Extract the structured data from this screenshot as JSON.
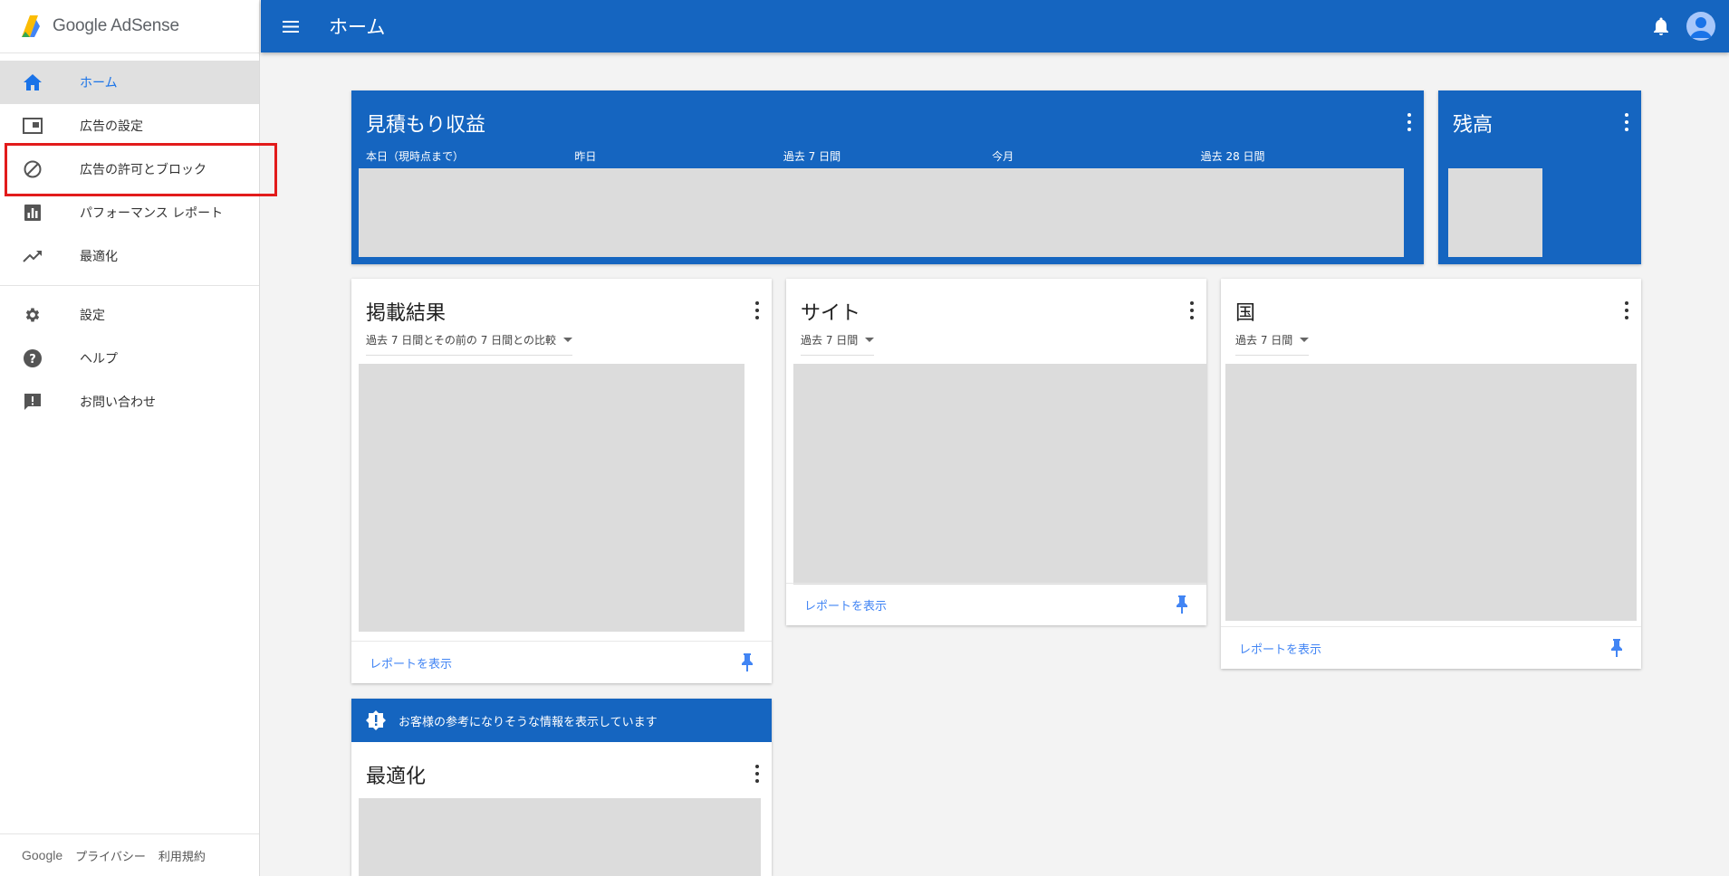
{
  "app": {
    "logo_text": "Google AdSense"
  },
  "header": {
    "title": "ホーム"
  },
  "sidebar": {
    "items": [
      {
        "label": "ホーム",
        "icon": "home-icon",
        "active": true
      },
      {
        "label": "広告の設定",
        "icon": "ad-settings-icon"
      },
      {
        "label": "広告の許可とブロック",
        "icon": "block-icon"
      },
      {
        "label": "パフォーマンス レポート",
        "icon": "bar-chart-icon"
      },
      {
        "label": "最適化",
        "icon": "trending-up-icon"
      },
      {
        "label": "設定",
        "icon": "gear-icon"
      },
      {
        "label": "ヘルプ",
        "icon": "help-icon"
      },
      {
        "label": "お問い合わせ",
        "icon": "feedback-icon"
      }
    ],
    "footer": {
      "google": "Google",
      "privacy": "プライバシー",
      "terms": "利用規約"
    }
  },
  "cards": {
    "estimated": {
      "title": "見積もり収益",
      "periods": [
        "本日（現時点まで）",
        "昨日",
        "過去 7 日間",
        "今月",
        "過去 28 日間"
      ]
    },
    "balance": {
      "title": "残高"
    },
    "results": {
      "title": "掲載結果",
      "selector": "過去 7 日間とその前の 7 日間との比較",
      "link": "レポートを表示"
    },
    "sites": {
      "title": "サイト",
      "selector": "過去 7 日間",
      "link": "レポートを表示"
    },
    "countries": {
      "title": "国",
      "selector": "過去 7 日間",
      "link": "レポートを表示"
    },
    "optimization": {
      "banner": "お客様の参考になりそうな情報を表示しています",
      "title": "最適化"
    }
  },
  "colors": {
    "brand": "#1565c0",
    "link": "#4285f4",
    "highlight": "#e21b1b"
  }
}
